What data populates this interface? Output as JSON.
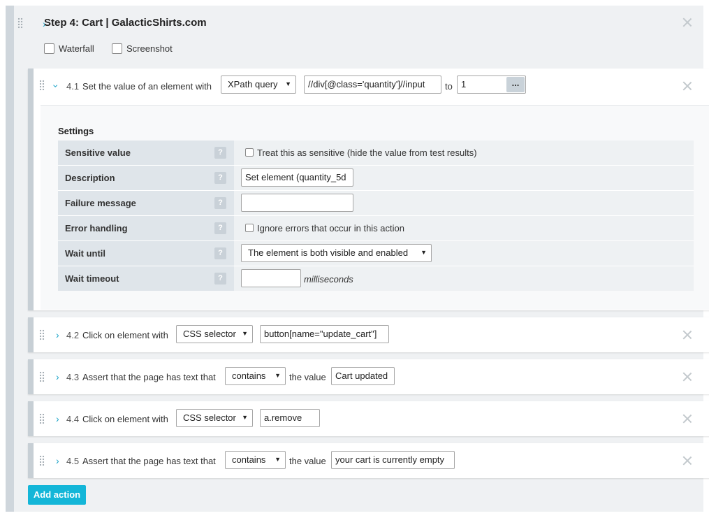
{
  "step": {
    "title": "Step 4: Cart | GalacticShirts.com",
    "options": [
      {
        "label": "Waterfall",
        "checked": false
      },
      {
        "label": "Screenshot",
        "checked": false
      }
    ]
  },
  "actions": [
    {
      "number": "4.1",
      "text": "Set the value of an element with",
      "selector_type": "XPath query",
      "selector": "//div[@class='quantity']//input",
      "connector": "to",
      "value": "1",
      "more_label": "...",
      "expanded": true
    },
    {
      "number": "4.2",
      "text": "Click on element with",
      "selector_type": "CSS selector",
      "selector": "button[name=\"update_cart\"]"
    },
    {
      "number": "4.3",
      "text": "Assert that the page has text that",
      "operator": "contains",
      "connector": "the value",
      "value": "Cart updated"
    },
    {
      "number": "4.4",
      "text": "Click on element with",
      "selector_type": "CSS selector",
      "selector": "a.remove"
    },
    {
      "number": "4.5",
      "text": "Assert that the page has text that",
      "operator": "contains",
      "connector": "the value",
      "value": "your cart is currently empty"
    }
  ],
  "settings": {
    "title": "Settings",
    "help_glyph": "?",
    "rows": [
      {
        "label": "Sensitive value",
        "checkbox_label": "Treat this as sensitive (hide the value from test results)",
        "checked": false
      },
      {
        "label": "Description",
        "value": "Set element (quantity_5d"
      },
      {
        "label": "Failure message",
        "value": ""
      },
      {
        "label": "Error handling",
        "checkbox_label": "Ignore errors that occur in this action",
        "checked": false
      },
      {
        "label": "Wait until",
        "value": "The element is both visible and enabled"
      },
      {
        "label": "Wait timeout",
        "value": "",
        "unit": "milliseconds"
      }
    ]
  },
  "add_action_label": "Add action",
  "colors": {
    "accent": "#14b6d8",
    "chevron": "#1aa3c8",
    "label_bg": "#dfe5ea"
  }
}
